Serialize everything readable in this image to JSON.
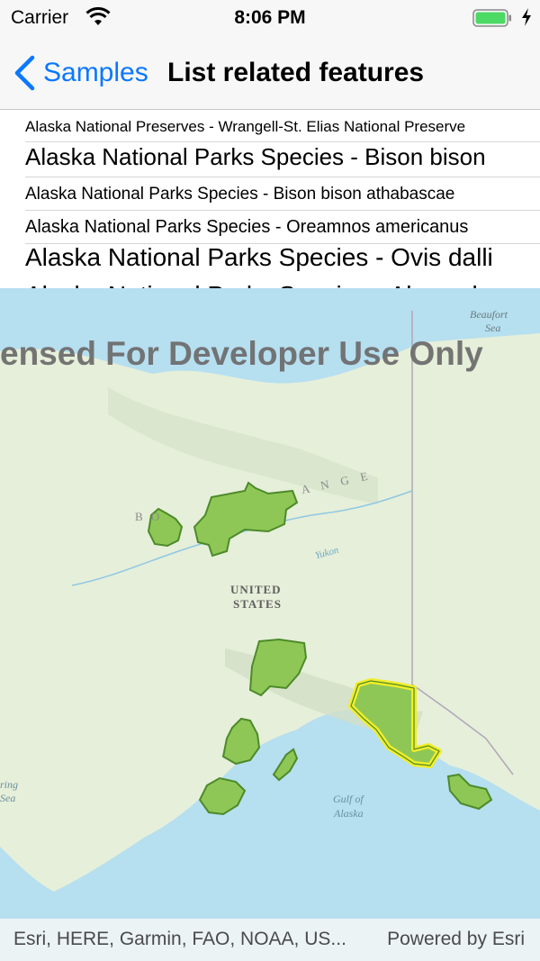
{
  "status_bar": {
    "carrier": "Carrier",
    "time": "8:06 PM"
  },
  "nav": {
    "back_label": "Samples",
    "title": "List related features"
  },
  "list": {
    "rows": [
      "Alaska National Preserves - Wrangell-St. Elias National Preserve",
      "Alaska National Parks Species - Bison bison",
      "Alaska National Parks Species - Bison bison athabascae",
      "Alaska National Parks Species - Oreamnos americanus",
      "Alaska National Parks Species - Ovis dalli",
      "Alaska National Parks Species - Alces alces"
    ]
  },
  "map": {
    "watermark": "ensed For Developer Use Only",
    "labels": {
      "beaufort": "Beaufort",
      "sea": "Sea",
      "united": "UNITED",
      "states": "STATES",
      "yukon": "Yukon",
      "range_left": "B   O",
      "range_right": "A N G E",
      "gulf": "Gulf of",
      "alaska": "Alaska",
      "bering": "ring",
      "bering_sea": "Sea"
    },
    "colors": {
      "water": "#b6dff0",
      "land": "#e6efd9",
      "park_fill": "#8fc756",
      "park_stroke": "#4c8a2a",
      "selection": "#f2ee26"
    }
  },
  "attribution": {
    "sources": "Esri, HERE, Garmin, FAO, NOAA, US...",
    "powered_by": "Powered by Esri"
  }
}
